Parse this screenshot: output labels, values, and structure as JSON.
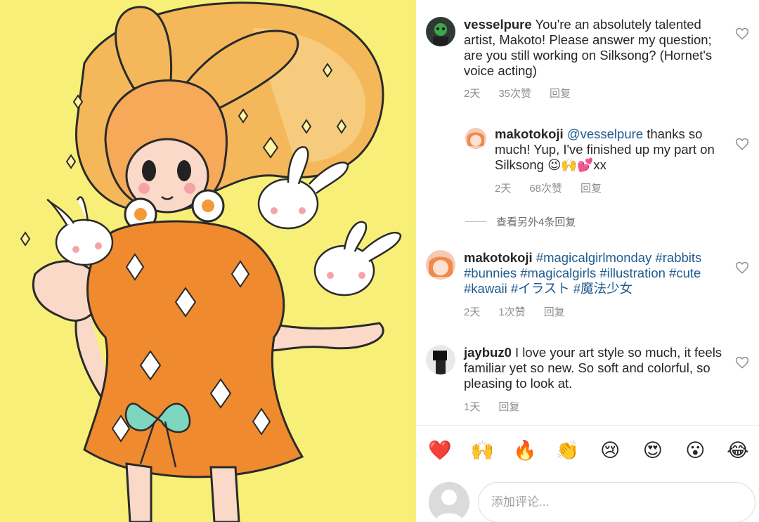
{
  "artwork": {
    "alt_icon": "magical-girl-illustration"
  },
  "comments": [
    {
      "user": "vesselpure",
      "text": "You're an absolutely talented artist, Makoto! Please answer my question; are you still working on Silksong? (Hornet's voice acting)",
      "time": "2天",
      "likes": "35次赞",
      "reply": "回复"
    },
    {
      "user": "makotokoji",
      "mention": "@vesselpure",
      "text": "thanks so much! Yup, I've finished up my part on Silksong 😉🙌💕xx",
      "time": "2天",
      "likes": "68次赞",
      "reply": "回复"
    },
    {
      "user": "makotokoji",
      "tags": "#magicalgirlmonday #rabbits #bunnies #magicalgirls #illustration #cute #kawaii #イラスト #魔法少女",
      "time": "2天",
      "likes": "1次赞",
      "reply": "回复"
    },
    {
      "user": "jaybuz0",
      "text": "I love your art style so much, it feels familiar yet so new. So soft and colorful, so pleasing to look at.",
      "time": "1天",
      "reply": "回复"
    }
  ],
  "more_replies": "查看另外4条回复",
  "emoji_bar": [
    "❤️",
    "🙌",
    "🔥",
    "👏",
    "😢",
    "😍",
    "😮",
    "😂"
  ],
  "composer": {
    "placeholder": "添加评论..."
  },
  "colors": {
    "link": "#1f5b8f",
    "meta": "#8e8e8e",
    "art_bg": "#f8ef78"
  }
}
